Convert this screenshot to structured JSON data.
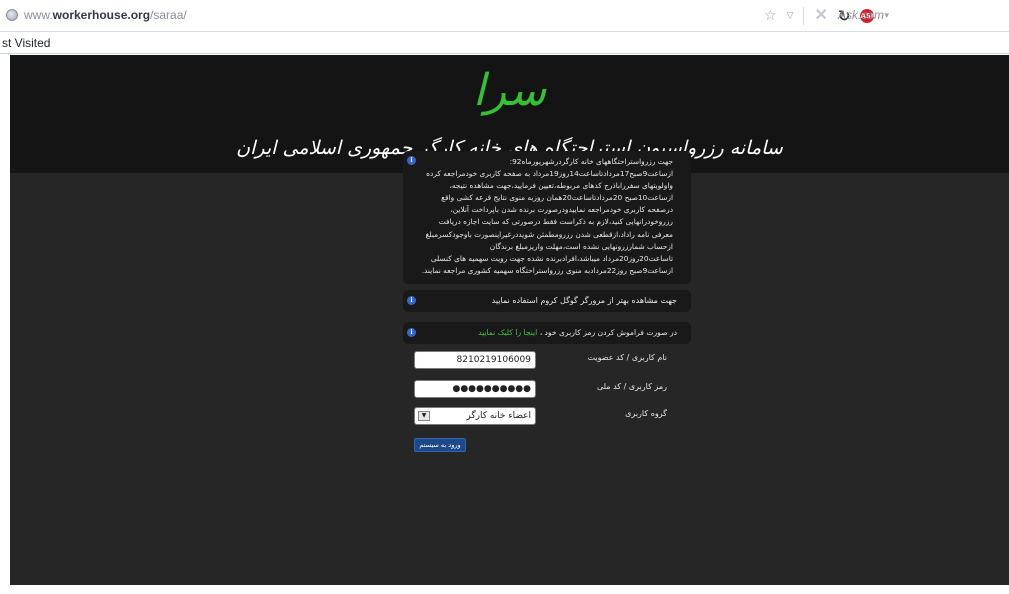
{
  "browser": {
    "url_prefix": "www.",
    "url_domain": "workerhouse.org",
    "url_path": "/saraa/",
    "search_engine": "Ask.com",
    "search_logo": "ASK",
    "bookmarks_label": "st Visited",
    "icons": [
      "globe-icon",
      "star-icon",
      "dropdown-icon",
      "stop-icon",
      "reload-icon",
      "ask-logo-icon"
    ]
  },
  "header": {
    "logo_text": "سرا",
    "site_title": "سامانه رزرواسیون استراحتگاه های خانه کارگر جمهوری اسلامی ایران",
    "logo_color": "#34c234"
  },
  "notices": {
    "main_lines": [
      "جهت رزرواستراحتگاههای خانه کارگردرشهریورماه92:",
      "ازساعت9صبح17مردادتاساعت14روز19مرداد به صفحه کاربری خودمراجعه کرده",
      "واولویتهای سفرراباذرج کدهای مربوطه،تعیین فرمایید،جهت مشاهده نتیجه،",
      "ازساعت10صبح 20مردادتاساعت20همان روزبه منوی نتایج قرعه کشی واقع",
      "درصفحه کاربری خودمراجعه نماییدودرصورت برنده شدن باپرداخت آنلاین،",
      "رزروخودرانهایی کنید،لازم به ذکراست فقط درصورتی که سایت اجازه دریافت",
      "معرفی نامه راداد،ازقطعی شدن رزرومطمئن شویددرغیراینصورت باوجودکسرمبلغ",
      "ازحساب شمارزرونهایی نشده است،مهلت واریزمبلغ برندگان",
      "تاساعت20روز20مرداد میباشد،افرادبرنده نشده جهت رویت سهمیه های کنسلی",
      "ازساعت9صبح روز22مردادبه منوی رزرواستراحتگاه سهمیه کشوری مراجعه نمایند."
    ],
    "browser_tip": "جهت مشاهده بهتر از مرورگر گوگل کروم استفاده نمایید",
    "forgot_prefix": "در صورت فراموش کردن رمز کاربری خود ،",
    "forgot_link": "اینجا را کلیک نمایید",
    "link_color": "#43c84a",
    "info_icon": "i"
  },
  "form": {
    "username_label": "نام کاربری / کد عضویت",
    "username_value": "8210219106009",
    "password_label": "رمز کاربری / کد ملی",
    "password_value": "●●●●●●●●●●",
    "group_label": "گروه کاربری",
    "group_value": "اعضاء خانه کارگر",
    "dropdown_glyph": "▼",
    "submit_label": "ورود به سیستم",
    "submit_color": "#1d4a86"
  }
}
